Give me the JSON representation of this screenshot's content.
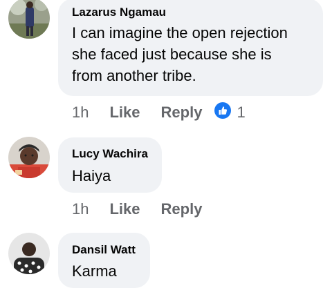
{
  "comments": [
    {
      "author": "Lazarus Ngamau",
      "text": "I can imagine the open rejection\nshe faced just because she is\nfrom another tribe.",
      "time": "1h",
      "like_label": "Like",
      "reply_label": "Reply",
      "reaction_icon": "thumbs-up-icon",
      "reaction_count": "1"
    },
    {
      "author": "Lucy Wachira",
      "text": "Haiya",
      "time": "1h",
      "like_label": "Like",
      "reply_label": "Reply"
    },
    {
      "author": "Dansil Watt",
      "text": "Karma"
    }
  ],
  "colors": {
    "bubble": "#f0f2f5",
    "secondary_text": "#65676b",
    "reaction_blue": "#1877f2"
  }
}
